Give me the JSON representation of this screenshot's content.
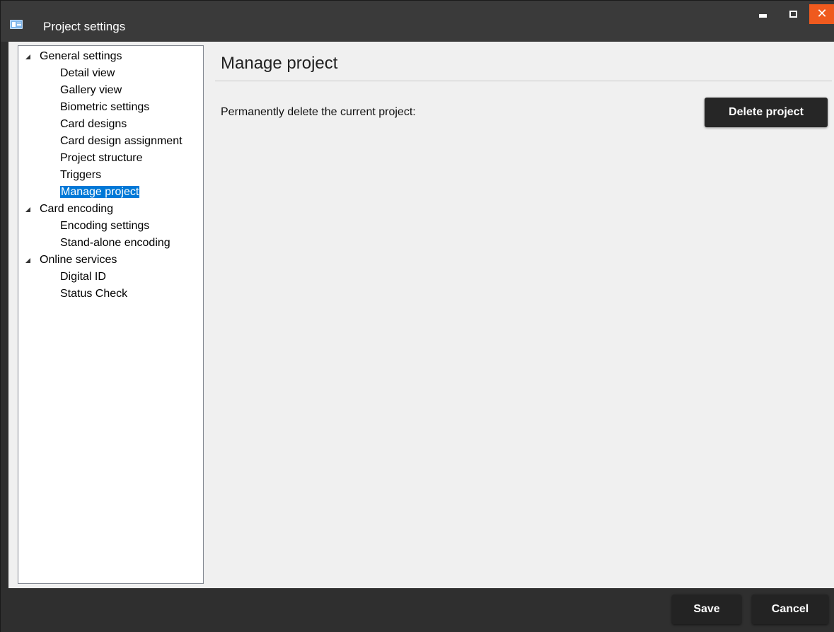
{
  "window": {
    "title": "Project settings",
    "controls": {
      "minimize": "minimize",
      "maximize": "maximize",
      "close": "✕"
    },
    "accent_close": "#ef5a1e"
  },
  "sidebar": {
    "groups": [
      {
        "label": "General settings",
        "items": [
          "Detail view",
          "Gallery view",
          "Biometric settings",
          "Card designs",
          "Card design assignment",
          "Project structure",
          "Triggers",
          "Manage project"
        ]
      },
      {
        "label": "Card encoding",
        "items": [
          "Encoding settings",
          "Stand-alone encoding"
        ]
      },
      {
        "label": "Online services",
        "items": [
          "Digital ID",
          "Status Check"
        ]
      }
    ],
    "selected": "Manage project",
    "selected_color": "#0078d7"
  },
  "main": {
    "title": "Manage project",
    "delete_label": "Permanently delete the current project:",
    "delete_button": "Delete project"
  },
  "footer": {
    "save": "Save",
    "cancel": "Cancel"
  }
}
